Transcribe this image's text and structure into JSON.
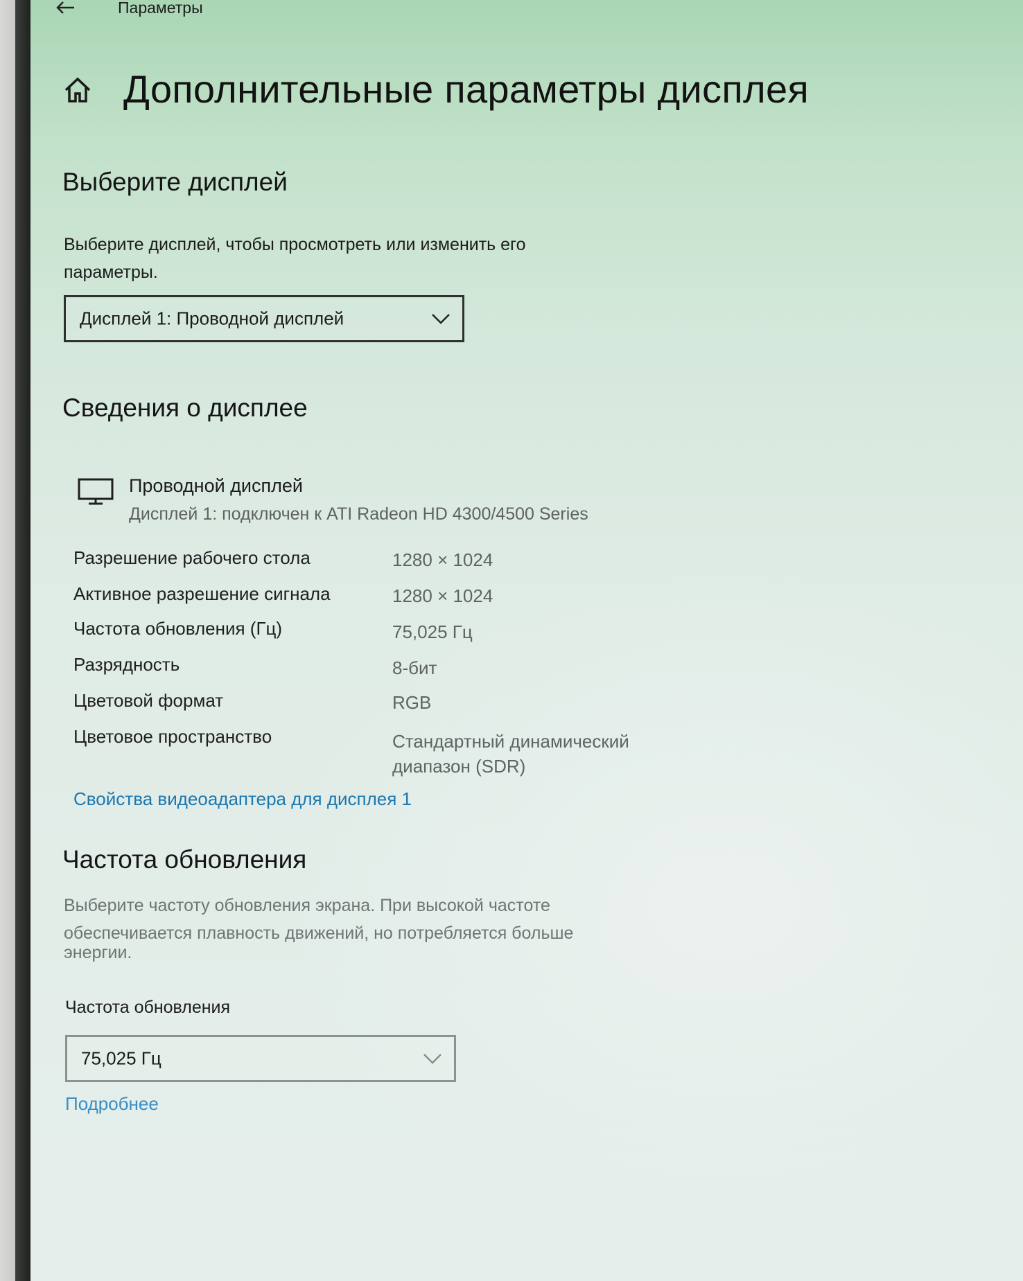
{
  "window": {
    "app_title": "Параметры"
  },
  "page": {
    "title": "Дополнительные параметры дисплея"
  },
  "select_display": {
    "heading": "Выберите дисплей",
    "description_line1": "Выберите дисплей, чтобы просмотреть или изменить его",
    "description_line2": "параметры.",
    "dropdown_value": "Дисплей 1: Проводной дисплей"
  },
  "display_info": {
    "heading": "Сведения о дисплее",
    "device_name": "Проводной дисплей",
    "device_subtitle": "Дисплей 1: подключен к ATI Radeon HD 4300/4500 Series",
    "rows": [
      {
        "label": "Разрешение рабочего стола",
        "value": "1280 × 1024"
      },
      {
        "label": "Активное разрешение сигнала",
        "value": "1280 × 1024"
      },
      {
        "label": "Частота обновления (Гц)",
        "value": "75,025 Гц"
      },
      {
        "label": "Разрядность",
        "value": "8-бит"
      },
      {
        "label": "Цветовой формат",
        "value": "RGB"
      },
      {
        "label": "Цветовое пространство",
        "value_line1": "Стандартный динамический",
        "value_line2": "диапазон (SDR)"
      }
    ],
    "adapter_link": "Свойства видеоадаптера для дисплея 1"
  },
  "refresh_rate": {
    "heading": "Частота обновления",
    "description_line1": "Выберите частоту обновления экрана. При высокой частоте",
    "description_line2": "обеспечивается плавность движений, но потребляется больше",
    "description_line3": "энергии.",
    "field_label": "Частота обновления",
    "dropdown_value": "75,025 Гц",
    "more_link": "Подробнее"
  },
  "icons": [
    "back-arrow-icon",
    "home-icon",
    "chevron-down-icon",
    "monitor-icon"
  ],
  "colors": {
    "link": "#1b78b0",
    "text": "#1c1c1c",
    "muted": "#6f7572"
  }
}
